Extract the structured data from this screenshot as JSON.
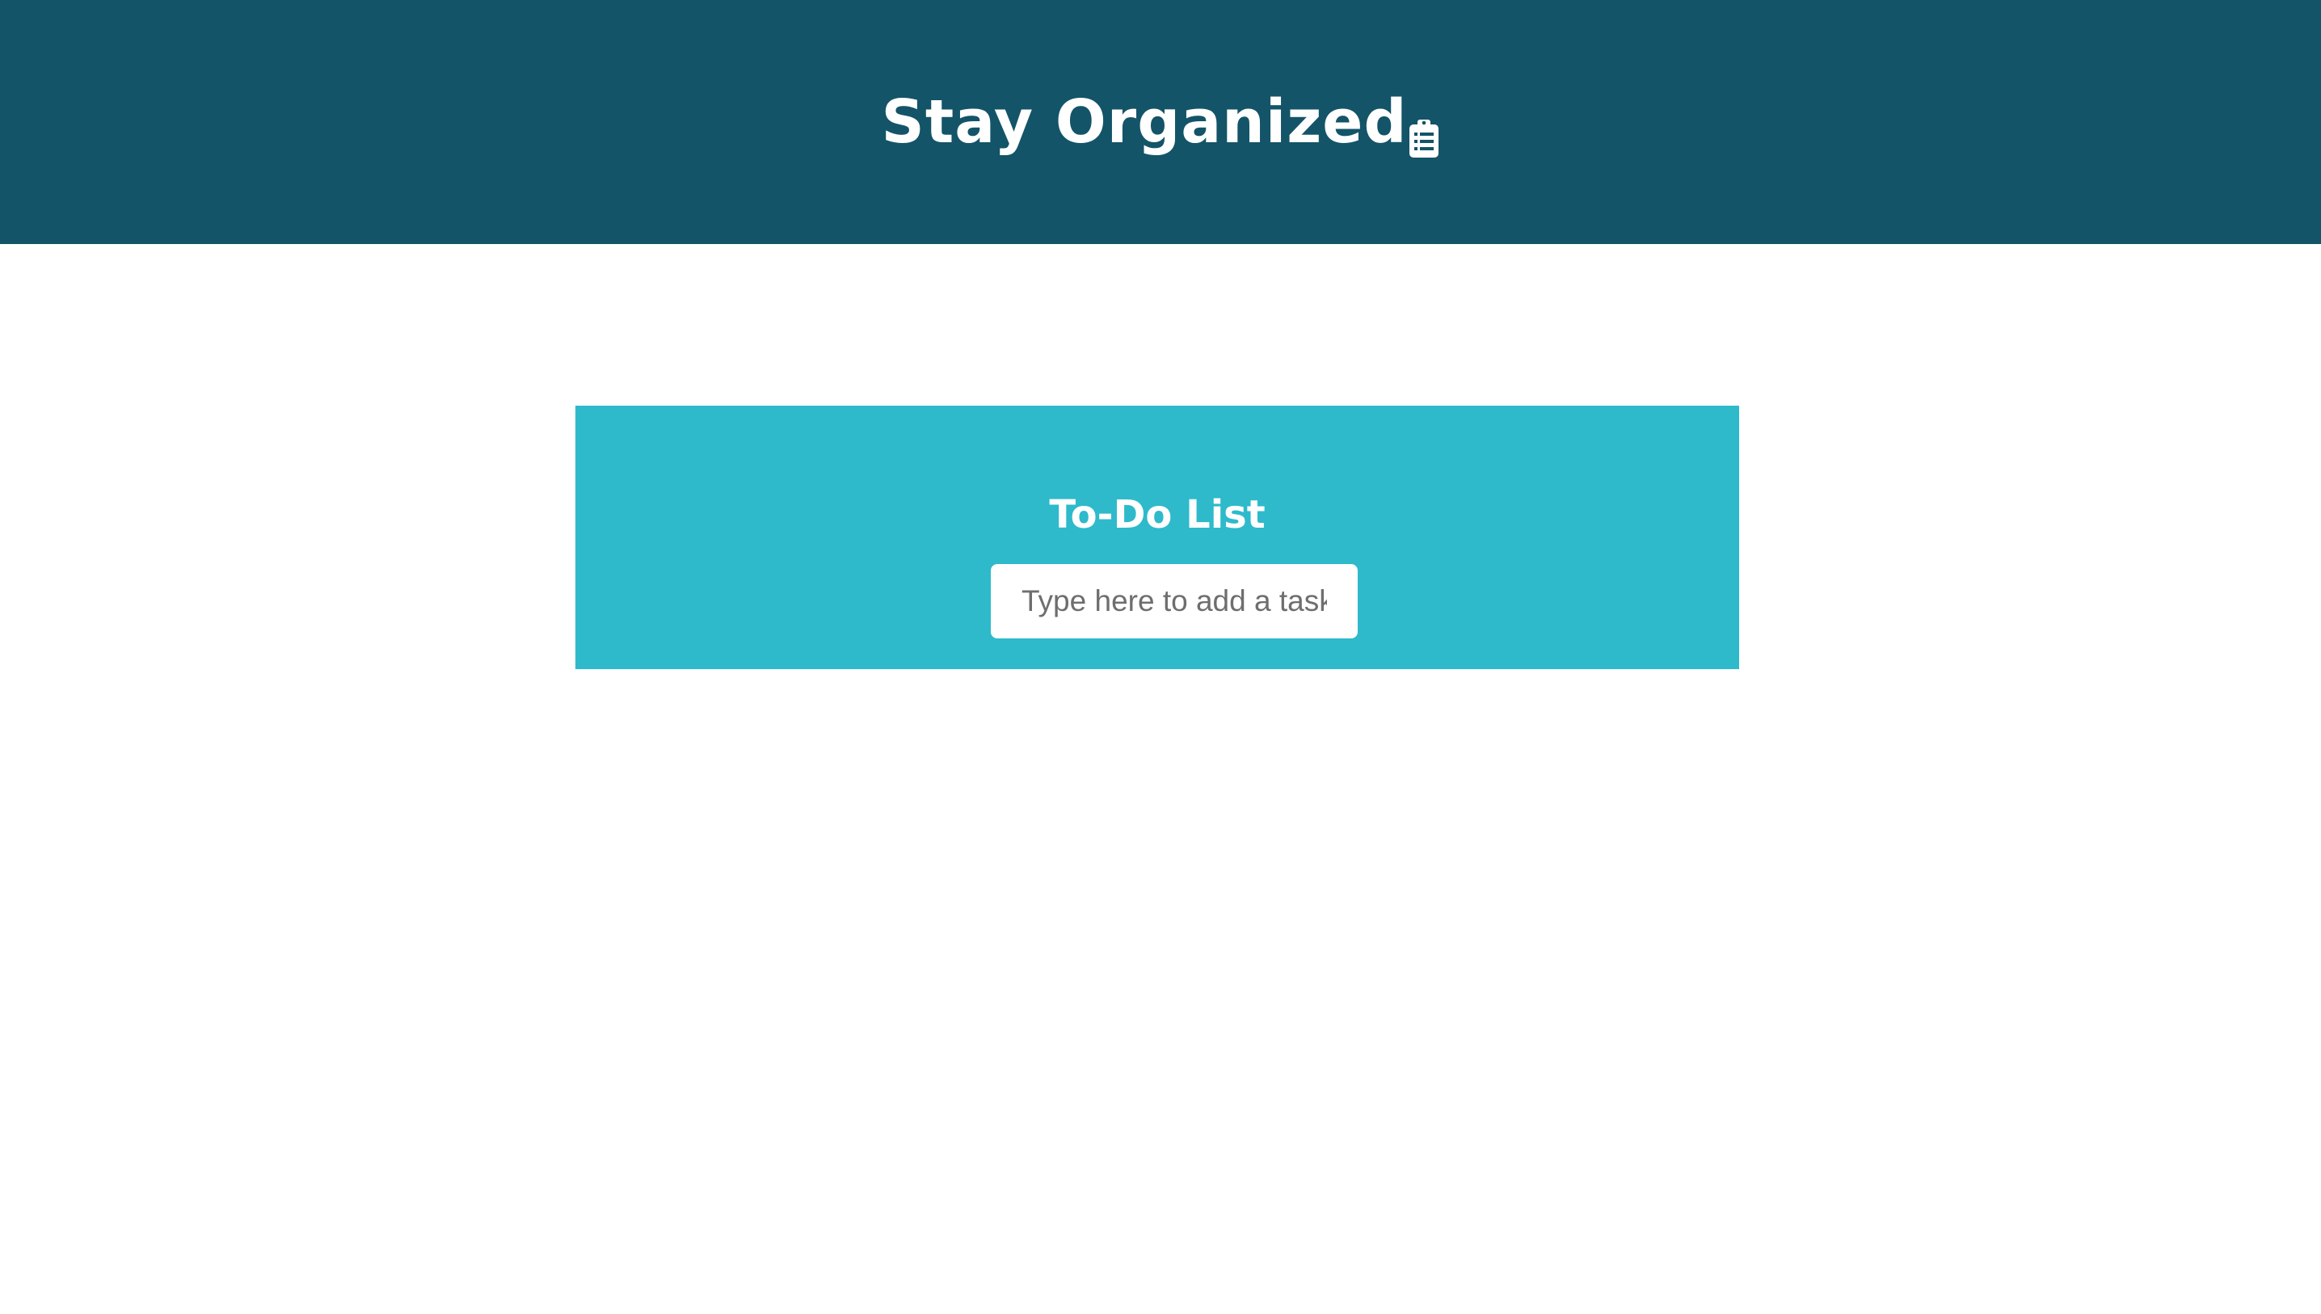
{
  "header": {
    "title": "Stay Organized",
    "icon": "clipboard-list-icon",
    "background": "#135468"
  },
  "todo": {
    "title": "To-Do List",
    "background": "#2ebacb",
    "input": {
      "placeholder": "Type here to add a task",
      "value": ""
    }
  }
}
